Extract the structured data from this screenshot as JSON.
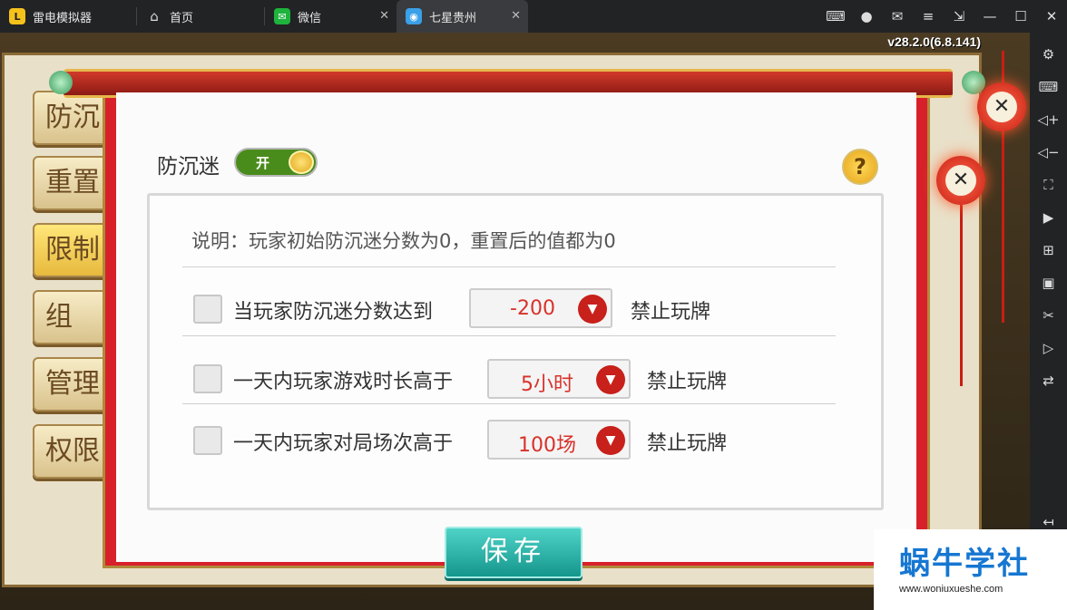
{
  "tabs": [
    {
      "label": "雷电模拟器",
      "icon": "ldplayer-logo-icon"
    },
    {
      "label": "首页",
      "icon": "home-icon"
    },
    {
      "label": "微信",
      "icon": "wechat-icon"
    },
    {
      "label": "七星贵州",
      "icon": "game-app-icon"
    }
  ],
  "version": "v28.2.0(6.8.141)",
  "dialog": {
    "toggle_label": "防沉迷",
    "toggle_state": "开",
    "help": "?",
    "description": "说明：玩家初始防沉迷分数为0，重置后的值都为0",
    "rules": [
      {
        "text": "当玩家防沉迷分数达到",
        "value": "-200",
        "suffix": "禁止玩牌",
        "checked": false
      },
      {
        "text": "一天内玩家游戏时长高于",
        "value": "5小时",
        "suffix": "禁止玩牌",
        "checked": false
      },
      {
        "text": "一天内玩家对局场次高于",
        "value": "100场",
        "suffix": "禁止玩牌",
        "checked": false
      }
    ],
    "save_label": "保存"
  },
  "side_menu": [
    "防沉",
    "重置",
    "限制",
    "组",
    "管理",
    "权限"
  ],
  "watermark": {
    "title": "蜗牛学社",
    "url": "www.woniuxueshe.com"
  },
  "colors": {
    "accent_red": "#d8322a",
    "save_teal": "#14968d",
    "toggle_green": "#4a8c1c"
  }
}
